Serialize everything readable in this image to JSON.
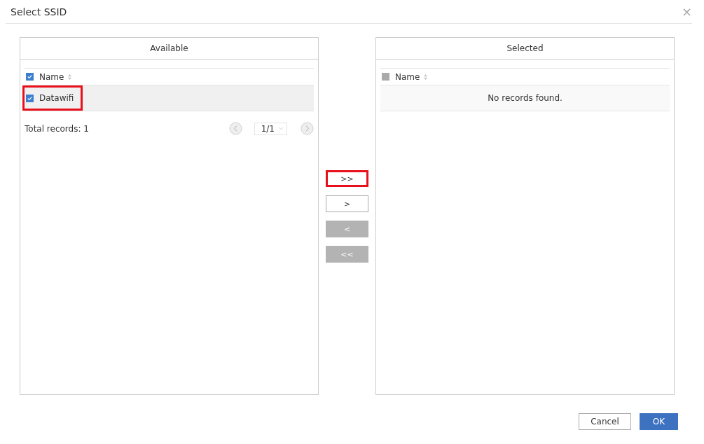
{
  "dialog": {
    "title": "Select SSID",
    "close_label": "×"
  },
  "available": {
    "title": "Available",
    "header": {
      "label": "Name",
      "checked": true
    },
    "rows": [
      {
        "name": "Datawifi",
        "checked": true,
        "selected": true,
        "highlighted": true
      }
    ],
    "total": "Total records: 1",
    "page": "1/1"
  },
  "transfer_buttons": [
    {
      "label": ">>",
      "disabled": false,
      "highlighted": true
    },
    {
      "label": ">",
      "disabled": false,
      "highlighted": false
    },
    {
      "label": "<",
      "disabled": true,
      "highlighted": false
    },
    {
      "label": "<<",
      "disabled": true,
      "highlighted": false
    }
  ],
  "selected": {
    "title": "Selected",
    "header": {
      "label": "Name",
      "checked": false
    },
    "empty": "No records found."
  },
  "buttons": [
    {
      "label": "Cancel",
      "kind": "secondary"
    },
    {
      "label": "OK",
      "kind": "primary"
    }
  ]
}
